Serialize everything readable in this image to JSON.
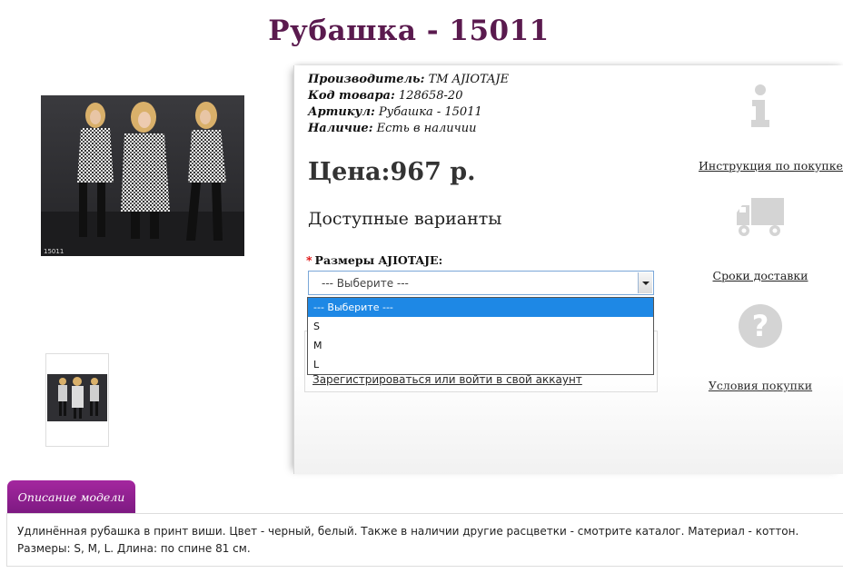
{
  "title": "Рубашка - 15011",
  "product": {
    "manufacturer_label": "Производитель:",
    "manufacturer_value": "ТМ AJIOTAJE",
    "code_label": "Код товара:",
    "code_value": "128658-20",
    "article_label": "Артикул:",
    "article_value": "Рубашка - 15011",
    "stock_label": "Наличие:",
    "stock_value": "Есть в наличии",
    "price": "Цена:967 р.",
    "variants_title": "Доступные варианты",
    "size_label": "Размеры AJIOTAJE:",
    "size_required_mark": "*",
    "size_selected": "--- Выберите ---",
    "size_options": [
      "--- Выберите ---",
      "S",
      "M",
      "L"
    ],
    "register_link": "Зарегистрироваться или войти в свой аккаунт"
  },
  "side": {
    "instruction_label": "Инструкция по покупке",
    "delivery_label": "Сроки доставки",
    "conditions_label": "Условия покупки",
    "info_icon": "info-icon",
    "truck_icon": "truck-icon",
    "question_icon": "question-icon"
  },
  "description": {
    "tab_label": "Описание модели",
    "text": "Удлинённая рубашка в принт виши. Цвет - черный, белый. Также в наличии другие расцветки - смотрите каталог. Материал - коттон. Размеры: S, M, L. Длина: по спине 81 см."
  },
  "image_caption": "15011",
  "colors": {
    "title": "#5a1a4e",
    "tab": "#8e1f8f",
    "highlight": "#1e88e5",
    "icon_gray": "#d4d4d4"
  }
}
